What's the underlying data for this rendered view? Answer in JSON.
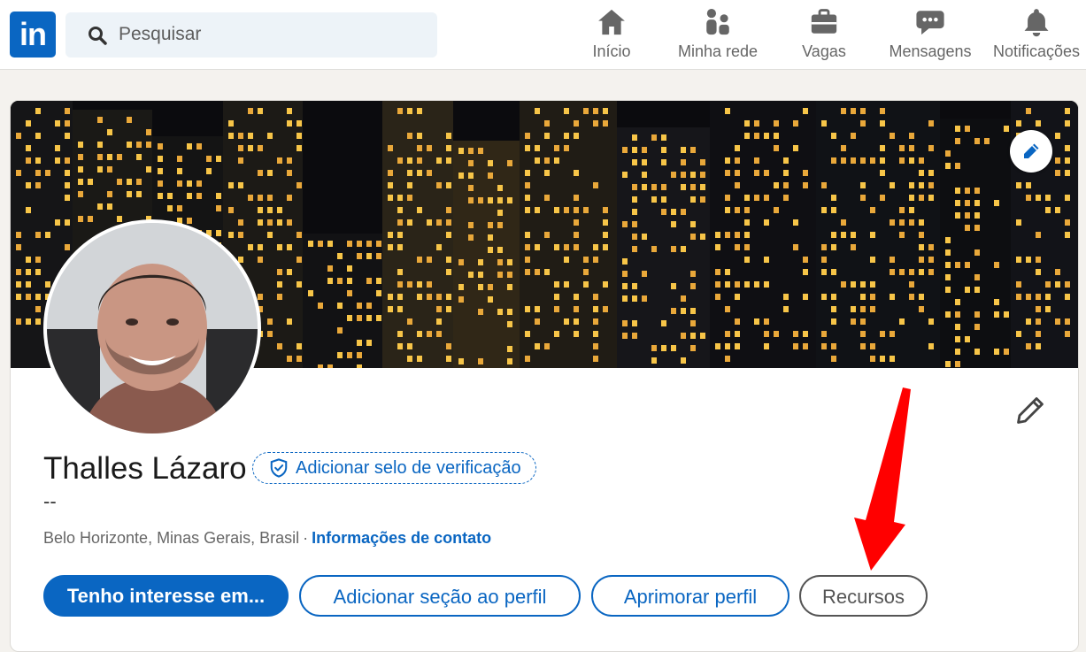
{
  "nav": {
    "logo_text": "in",
    "search_placeholder": "Pesquisar",
    "items": [
      {
        "label": "Início",
        "icon": "home-icon"
      },
      {
        "label": "Minha rede",
        "icon": "network-icon"
      },
      {
        "label": "Vagas",
        "icon": "briefcase-icon"
      },
      {
        "label": "Mensagens",
        "icon": "chat-icon"
      },
      {
        "label": "Notificações",
        "icon": "bell-icon"
      }
    ]
  },
  "profile": {
    "name": "Thalles Lázaro",
    "verify_badge": "Adicionar selo de verificação",
    "headline": "--",
    "location": "Belo Horizonte, Minas Gerais, Brasil",
    "separator": "·",
    "contact_link": "Informações de contato",
    "buttons": {
      "interest": "Tenho interesse em...",
      "add_section": "Adicionar seção ao perfil",
      "improve": "Aprimorar perfil",
      "resources": "Recursos"
    }
  },
  "colors": {
    "brand": "#0a66c2",
    "annotation_arrow": "#ff0000"
  }
}
